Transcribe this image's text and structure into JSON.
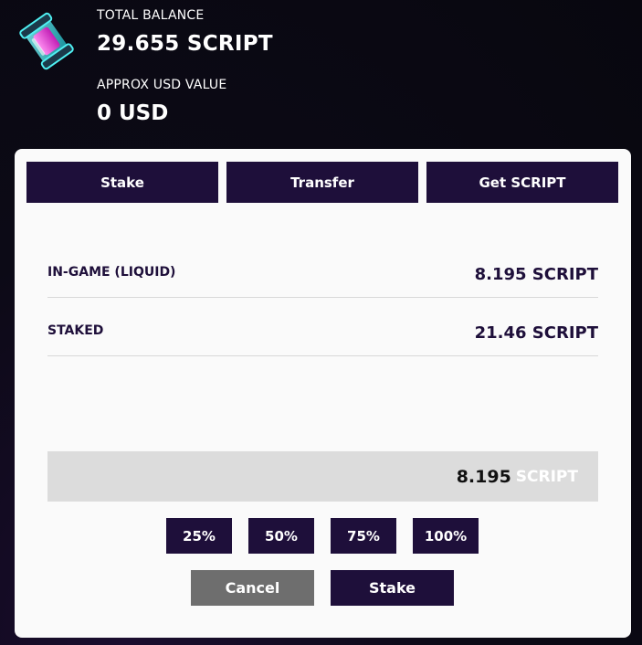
{
  "balance": {
    "total_label": "TOTAL BALANCE",
    "total_value": "29.655 SCRIPT",
    "usd_label": "APPROX USD VALUE",
    "usd_value": "0 USD"
  },
  "tabs": [
    {
      "label": "Stake"
    },
    {
      "label": "Transfer"
    },
    {
      "label": "Get SCRIPT"
    }
  ],
  "holdings": [
    {
      "label": "IN-GAME (LIQUID)",
      "value": "8.195 SCRIPT"
    },
    {
      "label": "STAKED",
      "value": "21.46 SCRIPT"
    }
  ],
  "amount": {
    "value": "8.195",
    "unit": "SCRIPT"
  },
  "percent_buttons": [
    "25%",
    "50%",
    "75%",
    "100%"
  ],
  "actions": {
    "cancel_label": "Cancel",
    "stake_label": "Stake"
  },
  "colors": {
    "primary": "#1e0f3a",
    "cancel": "#6e6e6e",
    "panel": "#fafafa",
    "icon_glow": "#33e0e6",
    "icon_core": "#e84ad8"
  },
  "icons": {
    "token": "script-canister-icon"
  }
}
